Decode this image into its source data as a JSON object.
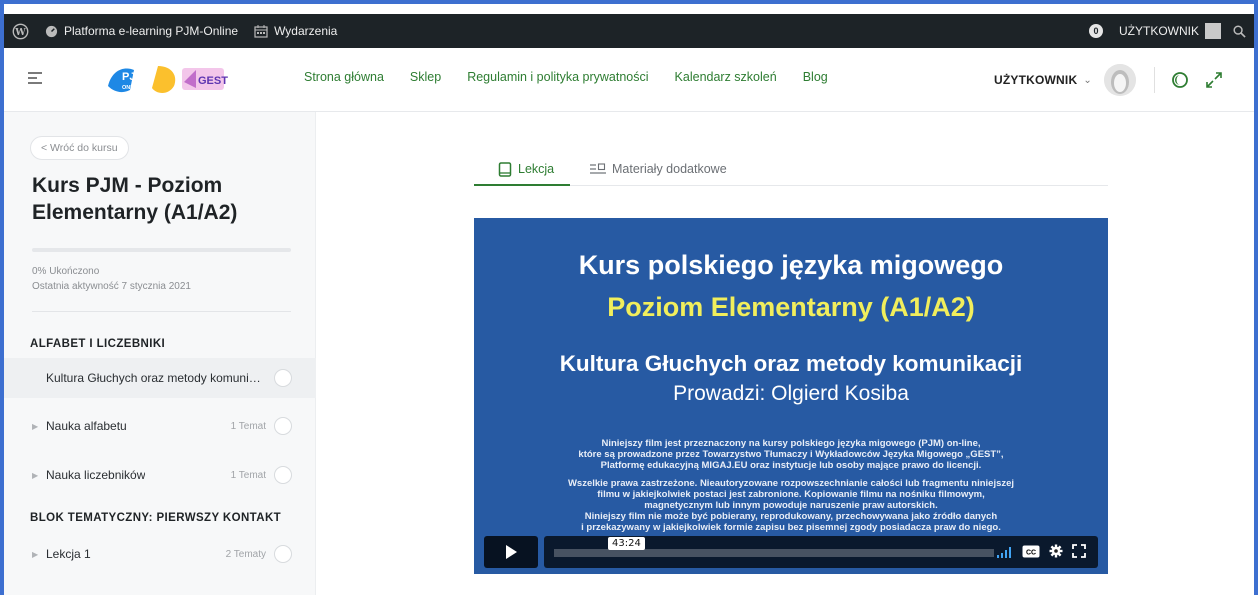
{
  "adminbar": {
    "site_name": "Platforma e-learning PJM-Online",
    "events": "Wydarzenia",
    "notification_count": "0",
    "user": "UŻYTKOWNIK"
  },
  "header": {
    "logo_text_1": "PJM",
    "logo_text_2": "ONLINE",
    "logo_text_3": "GEST",
    "nav": [
      "Strona główna",
      "Sklep",
      "Regulamin i polityka prywatności",
      "Kalendarz szkoleń",
      "Blog"
    ],
    "user_name": "UŻYTKOWNIK",
    "accent_color": "#2e7d32"
  },
  "sidebar": {
    "back_label": "< Wróć do kursu",
    "course_title": "Kurs PJM - Poziom Elementarny (A1/A2)",
    "progress_fraction": 0,
    "progress_label": "0% Ukończono",
    "last_activity": "Ostatnia aktywność 7 stycznia 2021",
    "sections": [
      {
        "title": "ALFABET I LICZEBNIKI",
        "items": [
          {
            "name": "Kultura Głuchych oraz metody komunika...",
            "count": "",
            "active": true
          },
          {
            "name": "Nauka alfabetu",
            "count": "1 Temat",
            "active": false
          },
          {
            "name": "Nauka liczebników",
            "count": "1 Temat",
            "active": false
          }
        ]
      },
      {
        "title": "BLOK TEMATYCZNY: PIERWSZY KONTAKT",
        "items": [
          {
            "name": "Lekcja 1",
            "count": "2 Tematy",
            "active": false
          }
        ]
      }
    ]
  },
  "tabs": {
    "lesson": "Lekcja",
    "materials": "Materiały dodatkowe"
  },
  "video": {
    "title_line1": "Kurs polskiego języka migowego",
    "title_line2": "Poziom Elementarny (A1/A2)",
    "title_line3": "Kultura Głuchych oraz metody komunikacji",
    "title_line4": "Prowadzi: Olgierd Kosiba",
    "para1_line1": "Niniejszy film jest przeznaczony na kursy polskiego języka migowego (PJM) on-line,",
    "para1_line2": "które są prowadzone przez Towarzystwo Tłumaczy i Wykładowców Języka Migowego „GEST”,",
    "para1_line3": "Platformę edukacyjną MIGAJ.EU oraz instytucje lub osoby mające prawo do licencji.",
    "para2_line1": "Wszelkie prawa zastrzeżone. Nieautoryzowane rozpowszechnianie całości lub fragmentu niniejszej",
    "para2_line2": "filmu w jakiejkolwiek postaci jest zabronione. Kopiowanie filmu na nośniku filmowym,",
    "para2_line3": "magnetycznym lub innym powoduje naruszenie praw autorskich.",
    "para2_line4": "Niniejszy film nie może być pobierany, reprodukowany, przechowywana jako źródło danych",
    "para2_line5": "i przekazywany w jakiejkolwiek formie zapisu bez pisemnej zgody posiadacza praw do niego.",
    "duration": "43:24",
    "background_color": "#275aa3",
    "highlight_color": "#f1ee5c"
  }
}
